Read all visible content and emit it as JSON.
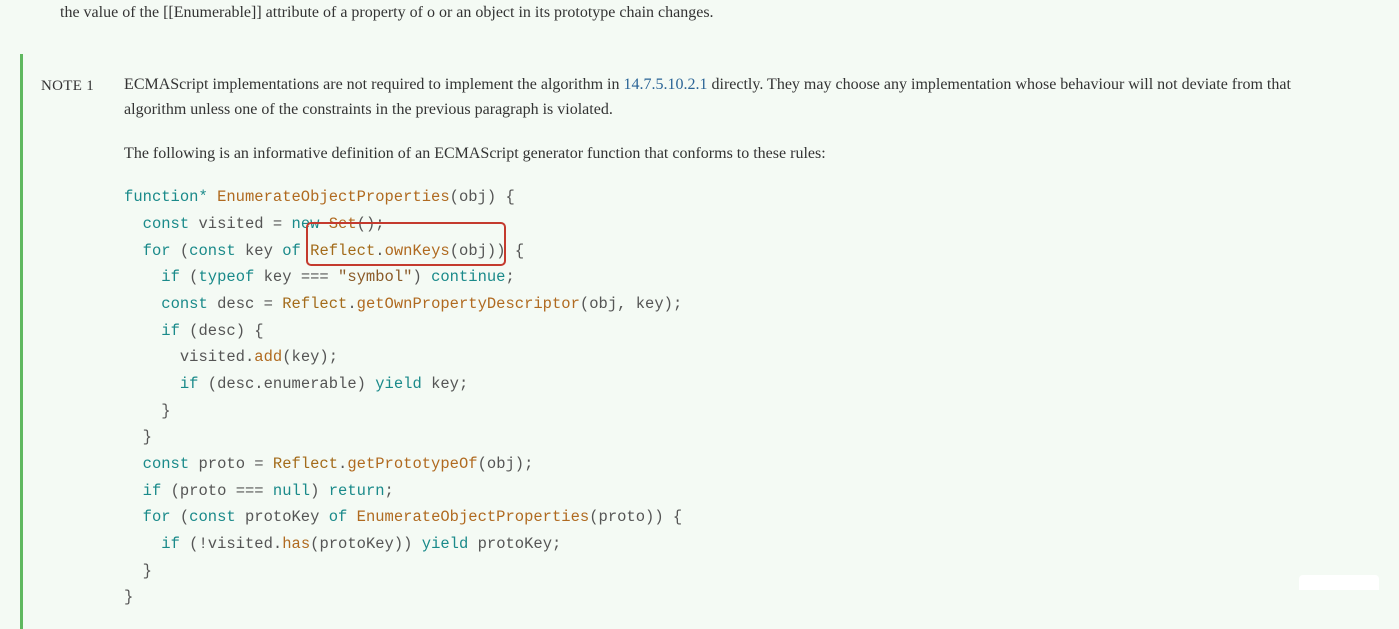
{
  "top_fragment": "the value of the [[Enumerable]] attribute of a property of o or an object in its prototype chain changes.",
  "note": {
    "label": "NOTE 1",
    "para1_pre": "ECMAScript implementations are not required to implement the algorithm in ",
    "para1_link": "14.7.5.10.2.1",
    "para1_post": " directly. They may choose any implementation whose behaviour will not deviate from that algorithm unless one of the constraints in the previous paragraph is violated.",
    "para2": "The following is an informative definition of an ECMAScript generator function that conforms to these rules:"
  },
  "code": {
    "kw_function_star": "function*",
    "fn_enum": "EnumerateObjectProperties",
    "id_obj": "obj",
    "kw_const": "const",
    "id_visited": "visited",
    "kw_new": "new",
    "cls_set": "Set",
    "kw_for": "for",
    "id_key": "key",
    "kw_of": "of",
    "obj_reflect": "Reflect",
    "fn_ownkeys": "ownKeys",
    "kw_if": "if",
    "kw_typeof": "typeof",
    "str_symbol": "\"symbol\"",
    "kw_continue": "continue",
    "id_desc": "desc",
    "fn_getdesc": "getOwnPropertyDescriptor",
    "fn_add": "add",
    "id_enumerable": "enumerable",
    "kw_yield": "yield",
    "id_proto": "proto",
    "fn_getproto": "getPrototypeOf",
    "kw_null": "null",
    "kw_return": "return",
    "id_protokey": "protoKey",
    "fn_has": "has"
  },
  "highlight": {
    "target": "Reflect.ownKeys(obj)"
  }
}
